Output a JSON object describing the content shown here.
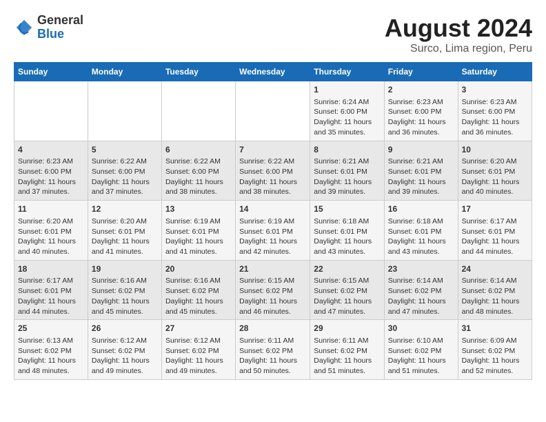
{
  "header": {
    "logo": {
      "general": "General",
      "blue": "Blue"
    },
    "title": "August 2024",
    "subtitle": "Surco, Lima region, Peru"
  },
  "calendar": {
    "days_of_week": [
      "Sunday",
      "Monday",
      "Tuesday",
      "Wednesday",
      "Thursday",
      "Friday",
      "Saturday"
    ],
    "weeks": [
      [
        {
          "day": "",
          "content": ""
        },
        {
          "day": "",
          "content": ""
        },
        {
          "day": "",
          "content": ""
        },
        {
          "day": "",
          "content": ""
        },
        {
          "day": "1",
          "content": "Sunrise: 6:24 AM\nSunset: 6:00 PM\nDaylight: 11 hours and 35 minutes."
        },
        {
          "day": "2",
          "content": "Sunrise: 6:23 AM\nSunset: 6:00 PM\nDaylight: 11 hours and 36 minutes."
        },
        {
          "day": "3",
          "content": "Sunrise: 6:23 AM\nSunset: 6:00 PM\nDaylight: 11 hours and 36 minutes."
        }
      ],
      [
        {
          "day": "4",
          "content": "Sunrise: 6:23 AM\nSunset: 6:00 PM\nDaylight: 11 hours and 37 minutes."
        },
        {
          "day": "5",
          "content": "Sunrise: 6:22 AM\nSunset: 6:00 PM\nDaylight: 11 hours and 37 minutes."
        },
        {
          "day": "6",
          "content": "Sunrise: 6:22 AM\nSunset: 6:00 PM\nDaylight: 11 hours and 38 minutes."
        },
        {
          "day": "7",
          "content": "Sunrise: 6:22 AM\nSunset: 6:00 PM\nDaylight: 11 hours and 38 minutes."
        },
        {
          "day": "8",
          "content": "Sunrise: 6:21 AM\nSunset: 6:01 PM\nDaylight: 11 hours and 39 minutes."
        },
        {
          "day": "9",
          "content": "Sunrise: 6:21 AM\nSunset: 6:01 PM\nDaylight: 11 hours and 39 minutes."
        },
        {
          "day": "10",
          "content": "Sunrise: 6:20 AM\nSunset: 6:01 PM\nDaylight: 11 hours and 40 minutes."
        }
      ],
      [
        {
          "day": "11",
          "content": "Sunrise: 6:20 AM\nSunset: 6:01 PM\nDaylight: 11 hours and 40 minutes."
        },
        {
          "day": "12",
          "content": "Sunrise: 6:20 AM\nSunset: 6:01 PM\nDaylight: 11 hours and 41 minutes."
        },
        {
          "day": "13",
          "content": "Sunrise: 6:19 AM\nSunset: 6:01 PM\nDaylight: 11 hours and 41 minutes."
        },
        {
          "day": "14",
          "content": "Sunrise: 6:19 AM\nSunset: 6:01 PM\nDaylight: 11 hours and 42 minutes."
        },
        {
          "day": "15",
          "content": "Sunrise: 6:18 AM\nSunset: 6:01 PM\nDaylight: 11 hours and 43 minutes."
        },
        {
          "day": "16",
          "content": "Sunrise: 6:18 AM\nSunset: 6:01 PM\nDaylight: 11 hours and 43 minutes."
        },
        {
          "day": "17",
          "content": "Sunrise: 6:17 AM\nSunset: 6:01 PM\nDaylight: 11 hours and 44 minutes."
        }
      ],
      [
        {
          "day": "18",
          "content": "Sunrise: 6:17 AM\nSunset: 6:01 PM\nDaylight: 11 hours and 44 minutes."
        },
        {
          "day": "19",
          "content": "Sunrise: 6:16 AM\nSunset: 6:02 PM\nDaylight: 11 hours and 45 minutes."
        },
        {
          "day": "20",
          "content": "Sunrise: 6:16 AM\nSunset: 6:02 PM\nDaylight: 11 hours and 45 minutes."
        },
        {
          "day": "21",
          "content": "Sunrise: 6:15 AM\nSunset: 6:02 PM\nDaylight: 11 hours and 46 minutes."
        },
        {
          "day": "22",
          "content": "Sunrise: 6:15 AM\nSunset: 6:02 PM\nDaylight: 11 hours and 47 minutes."
        },
        {
          "day": "23",
          "content": "Sunrise: 6:14 AM\nSunset: 6:02 PM\nDaylight: 11 hours and 47 minutes."
        },
        {
          "day": "24",
          "content": "Sunrise: 6:14 AM\nSunset: 6:02 PM\nDaylight: 11 hours and 48 minutes."
        }
      ],
      [
        {
          "day": "25",
          "content": "Sunrise: 6:13 AM\nSunset: 6:02 PM\nDaylight: 11 hours and 48 minutes."
        },
        {
          "day": "26",
          "content": "Sunrise: 6:12 AM\nSunset: 6:02 PM\nDaylight: 11 hours and 49 minutes."
        },
        {
          "day": "27",
          "content": "Sunrise: 6:12 AM\nSunset: 6:02 PM\nDaylight: 11 hours and 49 minutes."
        },
        {
          "day": "28",
          "content": "Sunrise: 6:11 AM\nSunset: 6:02 PM\nDaylight: 11 hours and 50 minutes."
        },
        {
          "day": "29",
          "content": "Sunrise: 6:11 AM\nSunset: 6:02 PM\nDaylight: 11 hours and 51 minutes."
        },
        {
          "day": "30",
          "content": "Sunrise: 6:10 AM\nSunset: 6:02 PM\nDaylight: 11 hours and 51 minutes."
        },
        {
          "day": "31",
          "content": "Sunrise: 6:09 AM\nSunset: 6:02 PM\nDaylight: 11 hours and 52 minutes."
        }
      ]
    ]
  }
}
